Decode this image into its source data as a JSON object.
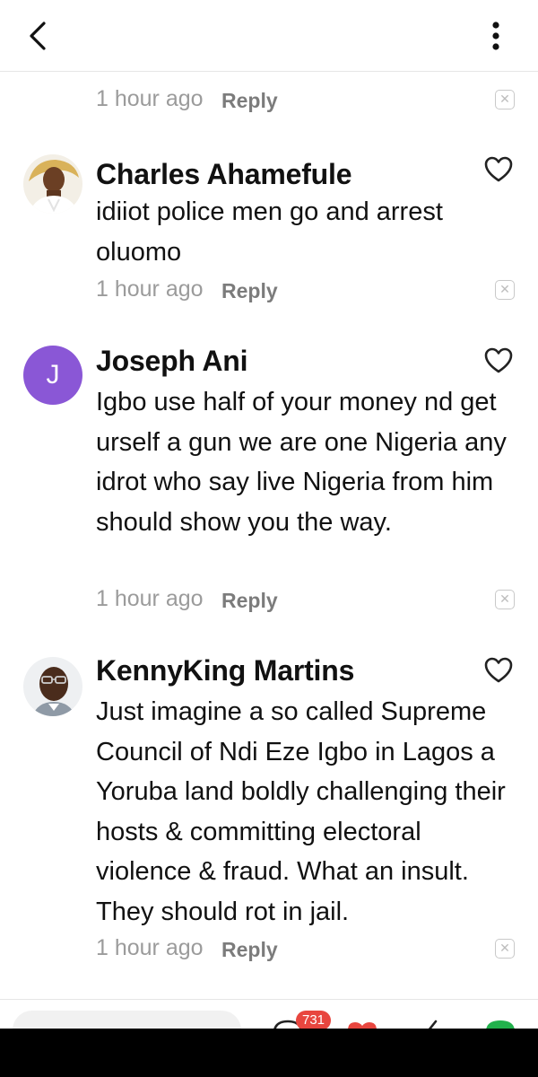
{
  "header": {
    "back_icon": "chevron-left-icon",
    "more_icon": "more-vertical-icon"
  },
  "previous_comment": {
    "time": "1 hour ago",
    "reply_label": "Reply"
  },
  "comments": [
    {
      "author": "Charles Ahamefule",
      "avatar": "photo",
      "text": "idiiot  police  men go and arrest oluomo",
      "time": "1 hour ago",
      "reply_label": "Reply"
    },
    {
      "author": "Joseph Ani",
      "avatar_letter": "J",
      "text": "Igbo use half of your money nd get urself a gun we are one Nigeria any idrot who say live Nigeria from him should show you the way.",
      "time": "1 hour ago",
      "reply_label": "Reply"
    },
    {
      "author": "KennyKing Martins",
      "avatar": "photo",
      "text": "Just imagine a so called Supreme Council of Ndi Eze Igbo in Lagos a Yoruba land boldly challenging their hosts & committing electoral violence & fraud. What an insult. They should rot in jail.",
      "time": "1 hour ago",
      "reply_label": "Reply"
    }
  ],
  "bottom_bar": {
    "comment_count": "731",
    "colors": {
      "badge": "#e8463f",
      "accent_purple": "#8a57d6"
    }
  }
}
